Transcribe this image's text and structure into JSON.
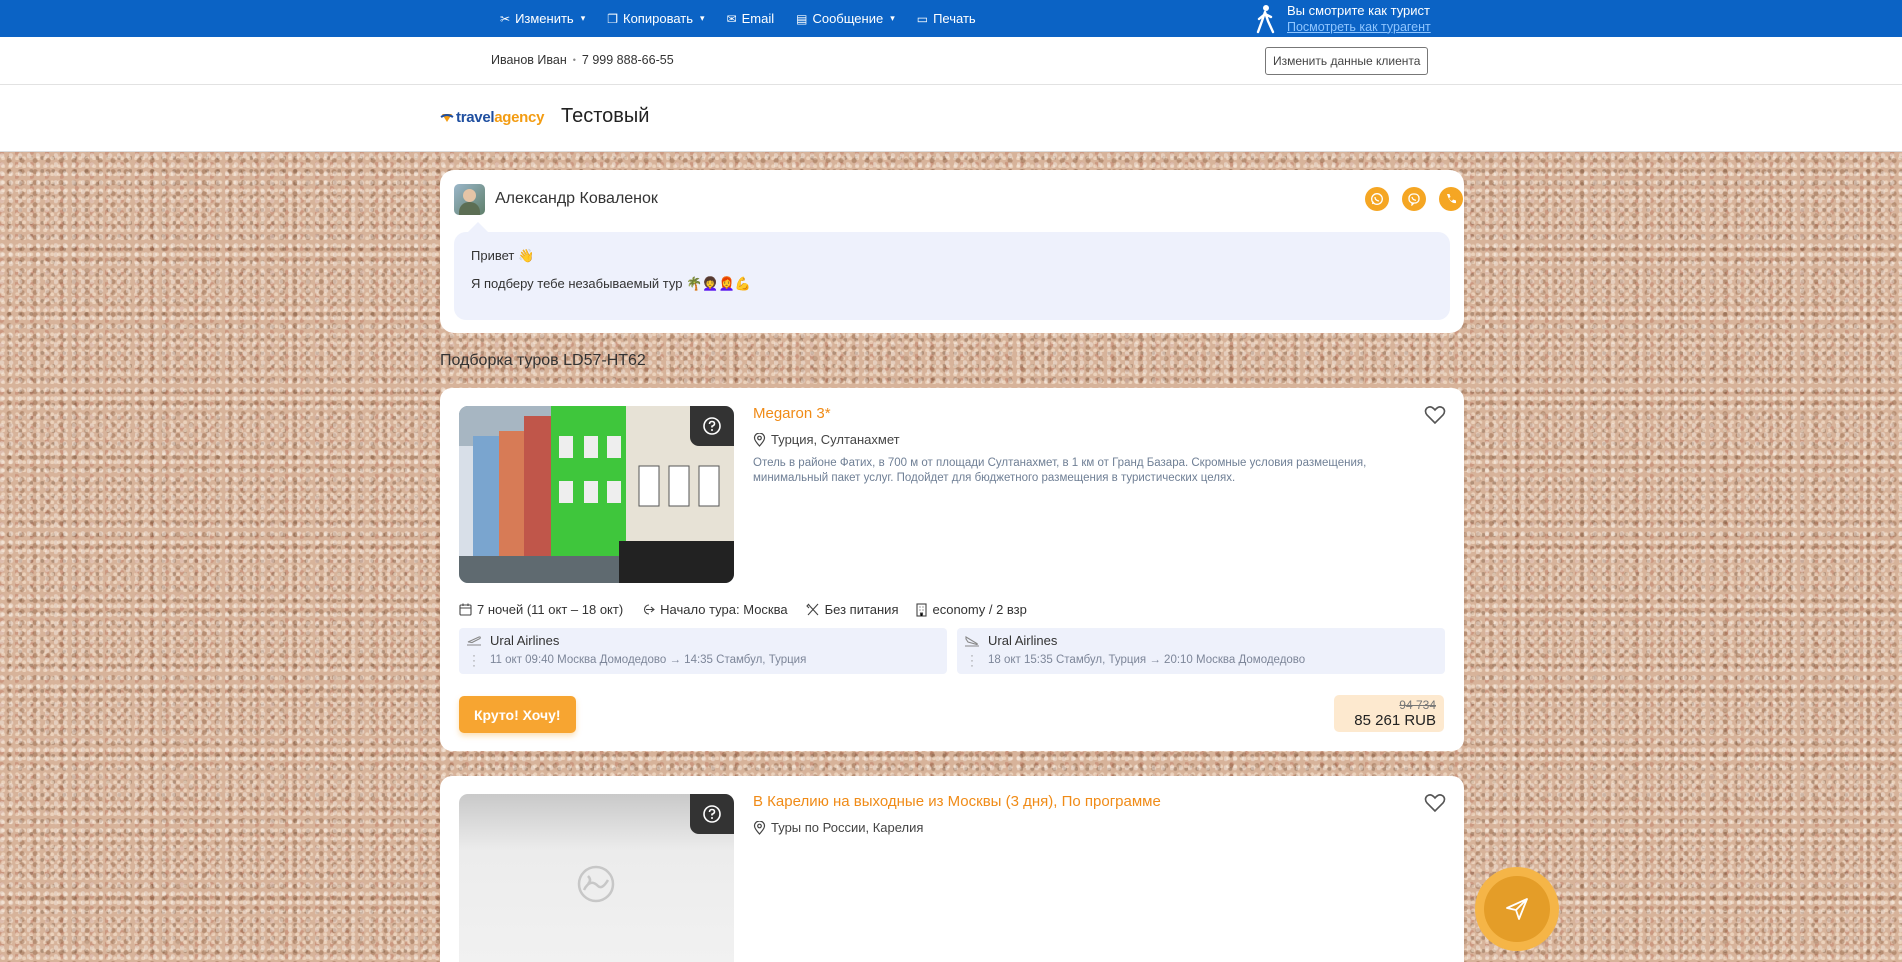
{
  "topbar": {
    "menu": [
      {
        "label": "Изменить",
        "icon": "tools-icon",
        "dropdown": true
      },
      {
        "label": "Копировать",
        "icon": "copy-icon",
        "dropdown": true
      },
      {
        "label": "Email",
        "icon": "envelope-icon",
        "dropdown": false
      },
      {
        "label": "Сообщение",
        "icon": "message-icon",
        "dropdown": true
      },
      {
        "label": "Печать",
        "icon": "print-icon",
        "dropdown": false
      }
    ],
    "viewer_text": "Вы смотрите как турист",
    "viewer_link": "Посмотреть как турагент"
  },
  "client": {
    "name": "Иванов Иван",
    "phone": "7 999 888-66-55",
    "edit_label": "Изменить данные клиента"
  },
  "brand": {
    "logo_part1": "travel",
    "logo_part2": "agency",
    "title": "Тестовый"
  },
  "agent": {
    "name": "Александр Коваленок",
    "contacts": [
      "whatsapp-icon",
      "viber-icon",
      "phone-icon"
    ],
    "greeting": "Привет 👋",
    "message": "Я подберу тебе незабываемый тур 🌴👩‍🦱👩‍🦰💪"
  },
  "section_title": "Подборка туров LD57-HT62",
  "tours": [
    {
      "name": "Megaron 3*",
      "location": "Турция, Султанахмет",
      "description": "Отель в районе Фатих, в 700 м от площади Султанахмет, в 1 км от Гранд Базара. Скромные условия размещения, минимальный пакет услуг. Подойдет для бюджетного размещения в туристических целях.",
      "nights": "7 ночей (11 окт – 18 окт)",
      "start": "Начало тура: Москва",
      "meal": "Без питания",
      "room": "economy / 2 взр",
      "flights": [
        {
          "airline": "Ural Airlines",
          "route": "11 окт 09:40 Москва Домодедово → 14:35 Стамбул, Турция"
        },
        {
          "airline": "Ural Airlines",
          "route": "18 окт 15:35 Стамбул, Турция → 20:10 Москва Домодедово"
        }
      ],
      "book_label": "Круто! Хочу!",
      "old_price": "94 734",
      "price": "85 261 RUB"
    },
    {
      "name": "В Карелию на выходные из Москвы (3 дня), По программе",
      "location": "Туры по России, Карелия"
    }
  ],
  "colors": {
    "topbar": "#0b63c5",
    "accent": "#f5a623",
    "hotel_name": "#f08b17"
  }
}
